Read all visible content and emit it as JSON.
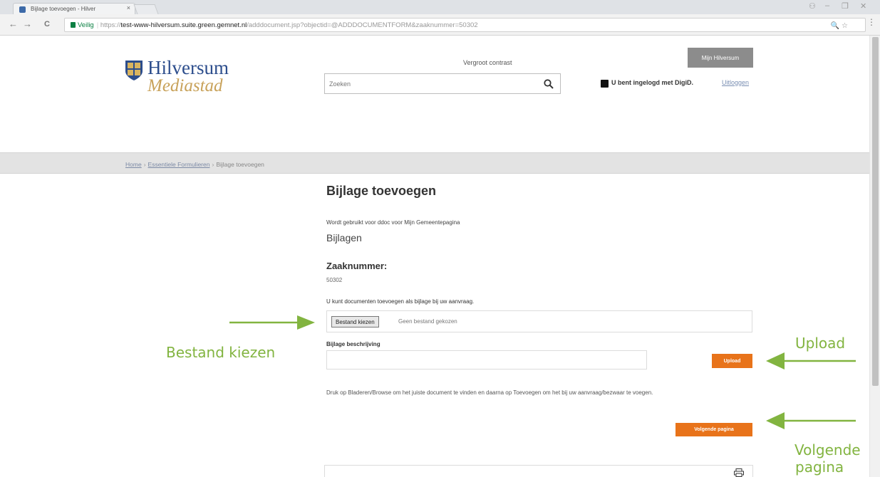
{
  "browser": {
    "tab_title": "Bijlage toevoegen - Hilver",
    "tab_close": "×",
    "window_controls": [
      "⚇",
      "‒",
      "❐",
      "✕"
    ],
    "nav": {
      "back": "←",
      "forward": "→",
      "reload": "C"
    },
    "address": {
      "secure_label": "Veilig",
      "url_scheme": "https://",
      "url_host": "test-www-hilversum.suite.green.gemnet.nl",
      "url_path": "/adddocument.jsp?objectid=@ADDDOCUMENTFORM&zaaknummer=50302"
    },
    "omnibox_icons": "🔍 ☆",
    "menu": "⋮"
  },
  "header": {
    "logo_line1": "Hilversum",
    "logo_line2": "Mediastad",
    "contrast_link": "Vergroot contrast",
    "mijn_button": "Mijn Hilversum",
    "search_placeholder": "Zoeken",
    "login_status": "U bent ingelogd met DigiD.",
    "logout": "Uitloggen"
  },
  "breadcrumb": {
    "items": [
      "Home",
      "Essentiele Formulieren",
      "Bijlage toevoegen"
    ],
    "separator": "›"
  },
  "main": {
    "title": "Bijlage toevoegen",
    "intro": "Wordt gebruikt voor ddoc voor Mijn Gemeentepagina",
    "section_title": "Bijlagen",
    "zaak_label": "Zaaknummer:",
    "zaak_value": "50302",
    "add_text": "U kunt documenten toevoegen als bijlage bij uw aanvraag.",
    "file_button": "Bestand kiezen",
    "file_none": "Geen bestand gekozen",
    "desc_label": "Bijlage beschrijving",
    "upload_button": "Upload",
    "help_text": "Druk op Bladeren/Browse om het juiste document te vinden en daarna op Toevoegen om het bij uw aanvraag/bezwaar te voegen.",
    "next_button": "Volgende pagina"
  },
  "annotations": {
    "file": "Bestand kiezen",
    "upload": "Upload",
    "next_line1": "Volgende",
    "next_line2": "pagina",
    "color": "#82b440"
  },
  "colors": {
    "orange": "#e8731a",
    "logo_blue": "#2c4d8c",
    "logo_gold": "#c8a25a"
  }
}
